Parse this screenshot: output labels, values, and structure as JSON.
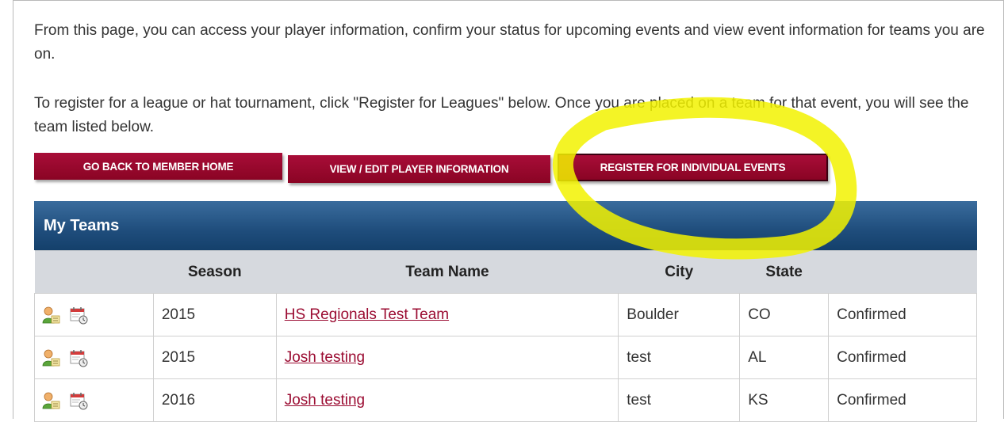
{
  "intro": {
    "paragraph_1": "From this page, you can access your player information, confirm your status for upcoming events and view event information for teams you are on.",
    "paragraph_2": "To register for a league or hat tournament, click \"Register for Leagues\" below.  Once you are placed on a team for that event, you will see the team listed below."
  },
  "buttons": {
    "home": "GO BACK TO MEMBER HOME",
    "player": "VIEW / EDIT PLAYER INFORMATION",
    "register": "REGISTER FOR INDIVIDUAL EVENTS"
  },
  "teams": {
    "title": "My Teams",
    "columns": {
      "icons": "",
      "season": "Season",
      "team_name": "Team Name",
      "city": "City",
      "state": "State",
      "status": ""
    },
    "rows": [
      {
        "season": "2015",
        "team_name": "HS Regionals Test Team",
        "city": "Boulder",
        "state": "CO",
        "status": "Confirmed"
      },
      {
        "season": "2015",
        "team_name": "Josh testing",
        "city": "test",
        "state": "AL",
        "status": "Confirmed"
      },
      {
        "season": "2016",
        "team_name": "Josh testing",
        "city": "test",
        "state": "KS",
        "status": "Confirmed"
      }
    ]
  },
  "colors": {
    "button": "#9b0a30",
    "header_blue": "#1f4d7c",
    "link": "#9b0c32",
    "highlight": "#f2f200"
  },
  "icons": {
    "row_player": "player-profile-icon",
    "row_schedule": "calendar-clock-icon"
  }
}
